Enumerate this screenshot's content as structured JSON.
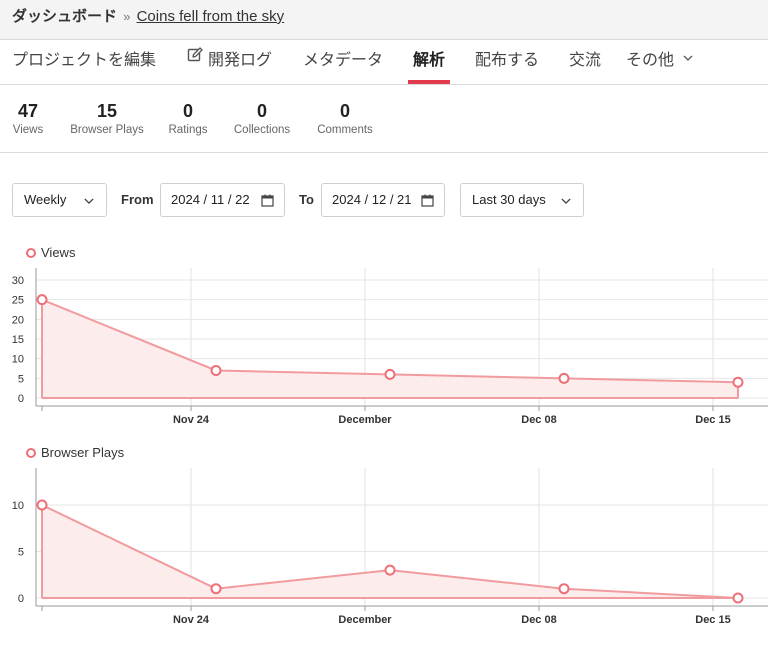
{
  "breadcrumb": {
    "root": "ダッシュボード",
    "separator": "»",
    "project": "Coins fell from the sky"
  },
  "tabs": [
    {
      "label": "プロジェクトを編集"
    },
    {
      "label": "開発ログ",
      "icon": "edit-icon"
    },
    {
      "label": "メタデータ"
    },
    {
      "label": "解析",
      "active": true
    },
    {
      "label": "配布する"
    },
    {
      "label": "交流"
    },
    {
      "label": "その他",
      "icon": "chevron-down-icon"
    }
  ],
  "stats": [
    {
      "value": "47",
      "label": "Views"
    },
    {
      "value": "15",
      "label": "Browser Plays"
    },
    {
      "value": "0",
      "label": "Ratings"
    },
    {
      "value": "0",
      "label": "Collections"
    },
    {
      "value": "0",
      "label": "Comments"
    }
  ],
  "controls": {
    "interval": "Weekly",
    "from_label": "From",
    "from_date": "2024 / 11 / 22",
    "to_label": "To",
    "to_date": "2024 / 12 / 21",
    "range": "Last 30 days"
  },
  "colors": {
    "accent": "#e23b4e",
    "series_line": "#f29b9f",
    "series_fill": "#fdecec",
    "point": "#ee6f77"
  },
  "chart_data": [
    {
      "type": "area",
      "x": [
        "2024-11-22",
        "2024-11-25",
        "2024-12-02",
        "2024-12-09",
        "2024-12-16"
      ],
      "series": [
        {
          "name": "Views",
          "values": [
            25,
            7,
            6,
            5,
            4
          ]
        }
      ],
      "xticks": [
        "Nov 24",
        "December",
        "Dec 08",
        "Dec 15"
      ],
      "yticks": [
        "0",
        "5",
        "10",
        "15",
        "20",
        "25",
        "30"
      ],
      "ylim": [
        0,
        30
      ],
      "grid": true,
      "legend": "top-left"
    },
    {
      "type": "area",
      "x": [
        "2024-11-22",
        "2024-11-25",
        "2024-12-02",
        "2024-12-09",
        "2024-12-16"
      ],
      "series": [
        {
          "name": "Browser Plays",
          "values": [
            10,
            1,
            3,
            1,
            0
          ]
        }
      ],
      "xticks": [
        "Nov 24",
        "December",
        "Dec 08",
        "Dec 15"
      ],
      "yticks": [
        "0",
        "5",
        "10"
      ],
      "ylim": [
        0,
        10
      ],
      "grid": true,
      "legend": "top-left"
    }
  ]
}
